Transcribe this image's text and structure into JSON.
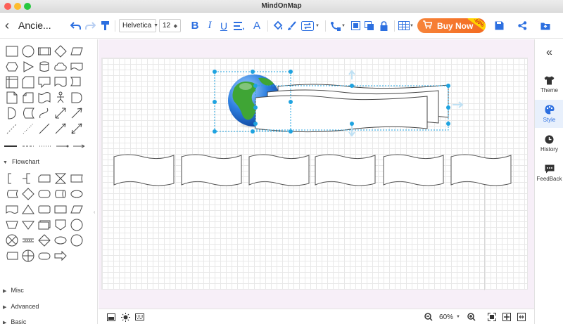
{
  "window": {
    "title": "MindOnMap"
  },
  "toolbar": {
    "doc_title": "Ancie...",
    "font_family": "Helvetica",
    "font_size": "12",
    "buy_label": "Buy Now",
    "discount": "-60%"
  },
  "left_panel": {
    "sections": [
      {
        "label": "Flowchart"
      },
      {
        "label": "Misc"
      },
      {
        "label": "Advanced"
      },
      {
        "label": "Basic"
      }
    ]
  },
  "right_panel": {
    "items": [
      {
        "label": "Theme",
        "icon": "shirt-icon"
      },
      {
        "label": "Style",
        "icon": "palette-icon"
      },
      {
        "label": "History",
        "icon": "clock-icon"
      },
      {
        "label": "FeedBack",
        "icon": "chat-icon"
      }
    ],
    "active": "Style"
  },
  "bottom_bar": {
    "zoom": "60%"
  },
  "colors": {
    "accent": "#2c6fe0",
    "buy": "#f36b21",
    "selection": "#1fa3e0"
  }
}
